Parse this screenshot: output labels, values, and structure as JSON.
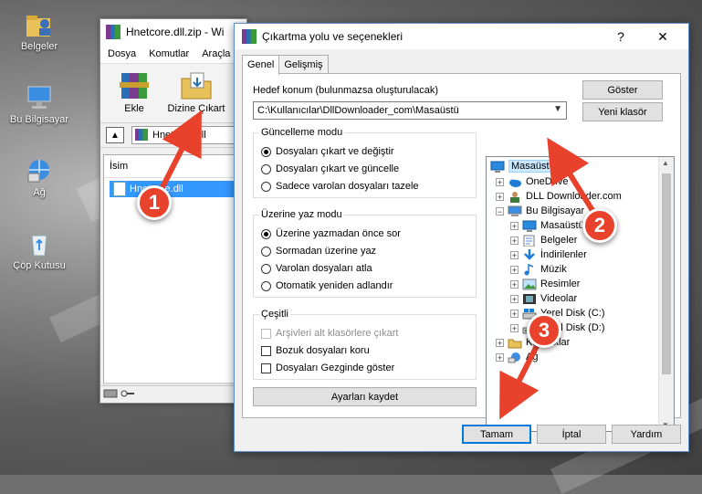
{
  "desktop": {
    "icons": [
      {
        "label": "Belgeler",
        "icon": "user-folder-icon"
      },
      {
        "label": "Bu Bilgisayar",
        "icon": "computer-icon"
      },
      {
        "label": "Ağ",
        "icon": "network-icon"
      },
      {
        "label": "Çöp Kutusu",
        "icon": "recycle-bin-icon"
      }
    ]
  },
  "winrar": {
    "title": "Hnetcore.dll.zip - Wi",
    "menu": [
      "Dosya",
      "Komutlar",
      "Araçla"
    ],
    "toolbar": {
      "add_label": "Ekle",
      "extract_label": "Dizine Çıkart"
    },
    "address": "Hnetcore.dll",
    "column_header": "İsim",
    "files": [
      {
        "name": "Hnetcore.dll"
      }
    ]
  },
  "dialog": {
    "title": "Çıkartma yolu ve seçenekleri",
    "help_glyph": "?",
    "close_glyph": "✕",
    "tabs": [
      {
        "label": "Genel",
        "active": true
      },
      {
        "label": "Gelişmiş",
        "active": false
      }
    ],
    "destination_label": "Hedef konum (bulunmazsa oluşturulacak)",
    "destination_value": "C:\\Kullanıcılar\\DllDownloader_com\\Masaüstü",
    "show_button": "Göster",
    "new_folder_button": "Yeni klasör",
    "update_mode": {
      "title": "Güncelleme modu",
      "options": [
        {
          "label": "Dosyaları çıkart ve değiştir",
          "selected": true
        },
        {
          "label": "Dosyaları çıkart ve güncelle",
          "selected": false
        },
        {
          "label": "Sadece varolan dosyaları tazele",
          "selected": false
        }
      ]
    },
    "overwrite_mode": {
      "title": "Üzerine yaz modu",
      "options": [
        {
          "label": "Üzerine yazmadan önce sor",
          "selected": true
        },
        {
          "label": "Sormadan üzerine yaz",
          "selected": false
        },
        {
          "label": "Varolan dosyaları atla",
          "selected": false
        },
        {
          "label": "Otomatik yeniden adlandır",
          "selected": false
        }
      ]
    },
    "misc": {
      "title": "Çeşitli",
      "options": [
        {
          "label": "Arşivleri alt klasörlere çıkart",
          "checked": false,
          "disabled": true
        },
        {
          "label": "Bozuk dosyaları koru",
          "checked": false,
          "disabled": false
        },
        {
          "label": "Dosyaları Gezginde göster",
          "checked": false,
          "disabled": false
        }
      ]
    },
    "save_settings_button": "Ayarları kaydet",
    "tree": [
      {
        "label": "Masaüstü",
        "icon": "desktop-icon",
        "selected": true
      },
      {
        "label": "OneDrive",
        "icon": "onedrive-icon"
      },
      {
        "label": "DLL Downloader.com",
        "icon": "user-icon"
      },
      {
        "label": "Bu Bilgisayar",
        "icon": "computer-icon"
      },
      {
        "label": "Masaüstü",
        "icon": "desktop-icon"
      },
      {
        "label": "Belgeler",
        "icon": "documents-icon"
      },
      {
        "label": "İndirilenler",
        "icon": "download-icon"
      },
      {
        "label": "Müzik",
        "icon": "music-icon"
      },
      {
        "label": "Resimler",
        "icon": "pictures-icon"
      },
      {
        "label": "Videolar",
        "icon": "videos-icon"
      },
      {
        "label": "Yerel Disk (C:)",
        "icon": "drive-icon"
      },
      {
        "label": "Yerel Disk (D:)",
        "icon": "drive-icon"
      },
      {
        "label": "Kitaplıklar",
        "icon": "library-icon"
      },
      {
        "label": "Ağ",
        "icon": "network-icon"
      }
    ],
    "ok_button": "Tamam",
    "cancel_button": "İptal",
    "help_button": "Yardım"
  },
  "annotations": {
    "step1": "1",
    "step2": "2",
    "step3": "3",
    "color": "#e8412c"
  }
}
